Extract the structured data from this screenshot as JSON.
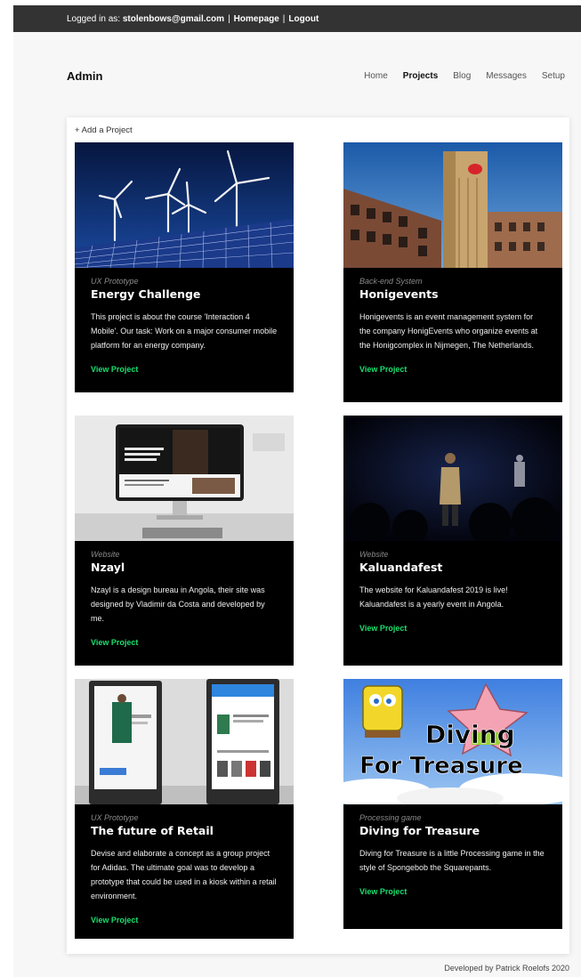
{
  "topbar": {
    "logged_in_label": "Logged in as:",
    "email": "stolenbows@gmail.com",
    "homepage_link": "Homepage",
    "logout_link": "Logout",
    "separator": "|"
  },
  "header": {
    "brand": "Admin",
    "nav": [
      {
        "label": "Home",
        "active": false
      },
      {
        "label": "Projects",
        "active": true
      },
      {
        "label": "Blog",
        "active": false
      },
      {
        "label": "Messages",
        "active": false
      },
      {
        "label": "Setup",
        "active": false
      }
    ]
  },
  "main": {
    "add_project": "+ Add a Project",
    "projects": [
      {
        "category": "UX Prototype",
        "title": "Energy Challenge",
        "description": "This project is about the course 'Interaction 4 Mobile'. Our task: Work on a major consumer mobile platform for an energy company.",
        "link": "View Project",
        "image": "wind-turbines-solar-panels"
      },
      {
        "category": "Back-end System",
        "title": "Honigevents",
        "description": "Honigevents is an event management system for the company HonigEvents who organize events at the Honigcomplex in Nijmegen, The Netherlands.",
        "link": "View Project",
        "image": "honig-factory-building"
      },
      {
        "category": "Website",
        "title": "Nzayl",
        "description": "Nzayl is a design bureau in Angola, their site was designed by Vladimir da Costa and developed by me.",
        "link": "View Project",
        "image": "website-on-monitor"
      },
      {
        "category": "Website",
        "title": "Kaluandafest",
        "description": "The website for Kaluandafest 2019 is live! Kaluandafest is a yearly event in Angola.",
        "link": "View Project",
        "image": "performer-on-stage"
      },
      {
        "category": "UX Prototype",
        "title": "The future of Retail",
        "description": "Devise and elaborate a concept as a group project for Adidas. The ultimate goal was to develop a prototype that could be used in a kiosk within a retail environment.",
        "link": "View Project",
        "image": "retail-kiosks"
      },
      {
        "category": "Processing game",
        "title": "Diving for Treasure",
        "description": "Diving for Treasure is a little Processing game in the style of Spongebob the Squarepants.",
        "link": "View Project",
        "image": "diving-for-treasure-title",
        "image_text": [
          "Diving",
          "For Treasure"
        ]
      }
    ]
  },
  "footer": {
    "text": "Developed by Patrick Roelofs 2020"
  },
  "colors": {
    "topbar_bg": "#333333",
    "card_bg": "#000000",
    "link_accent": "#19e06f"
  }
}
